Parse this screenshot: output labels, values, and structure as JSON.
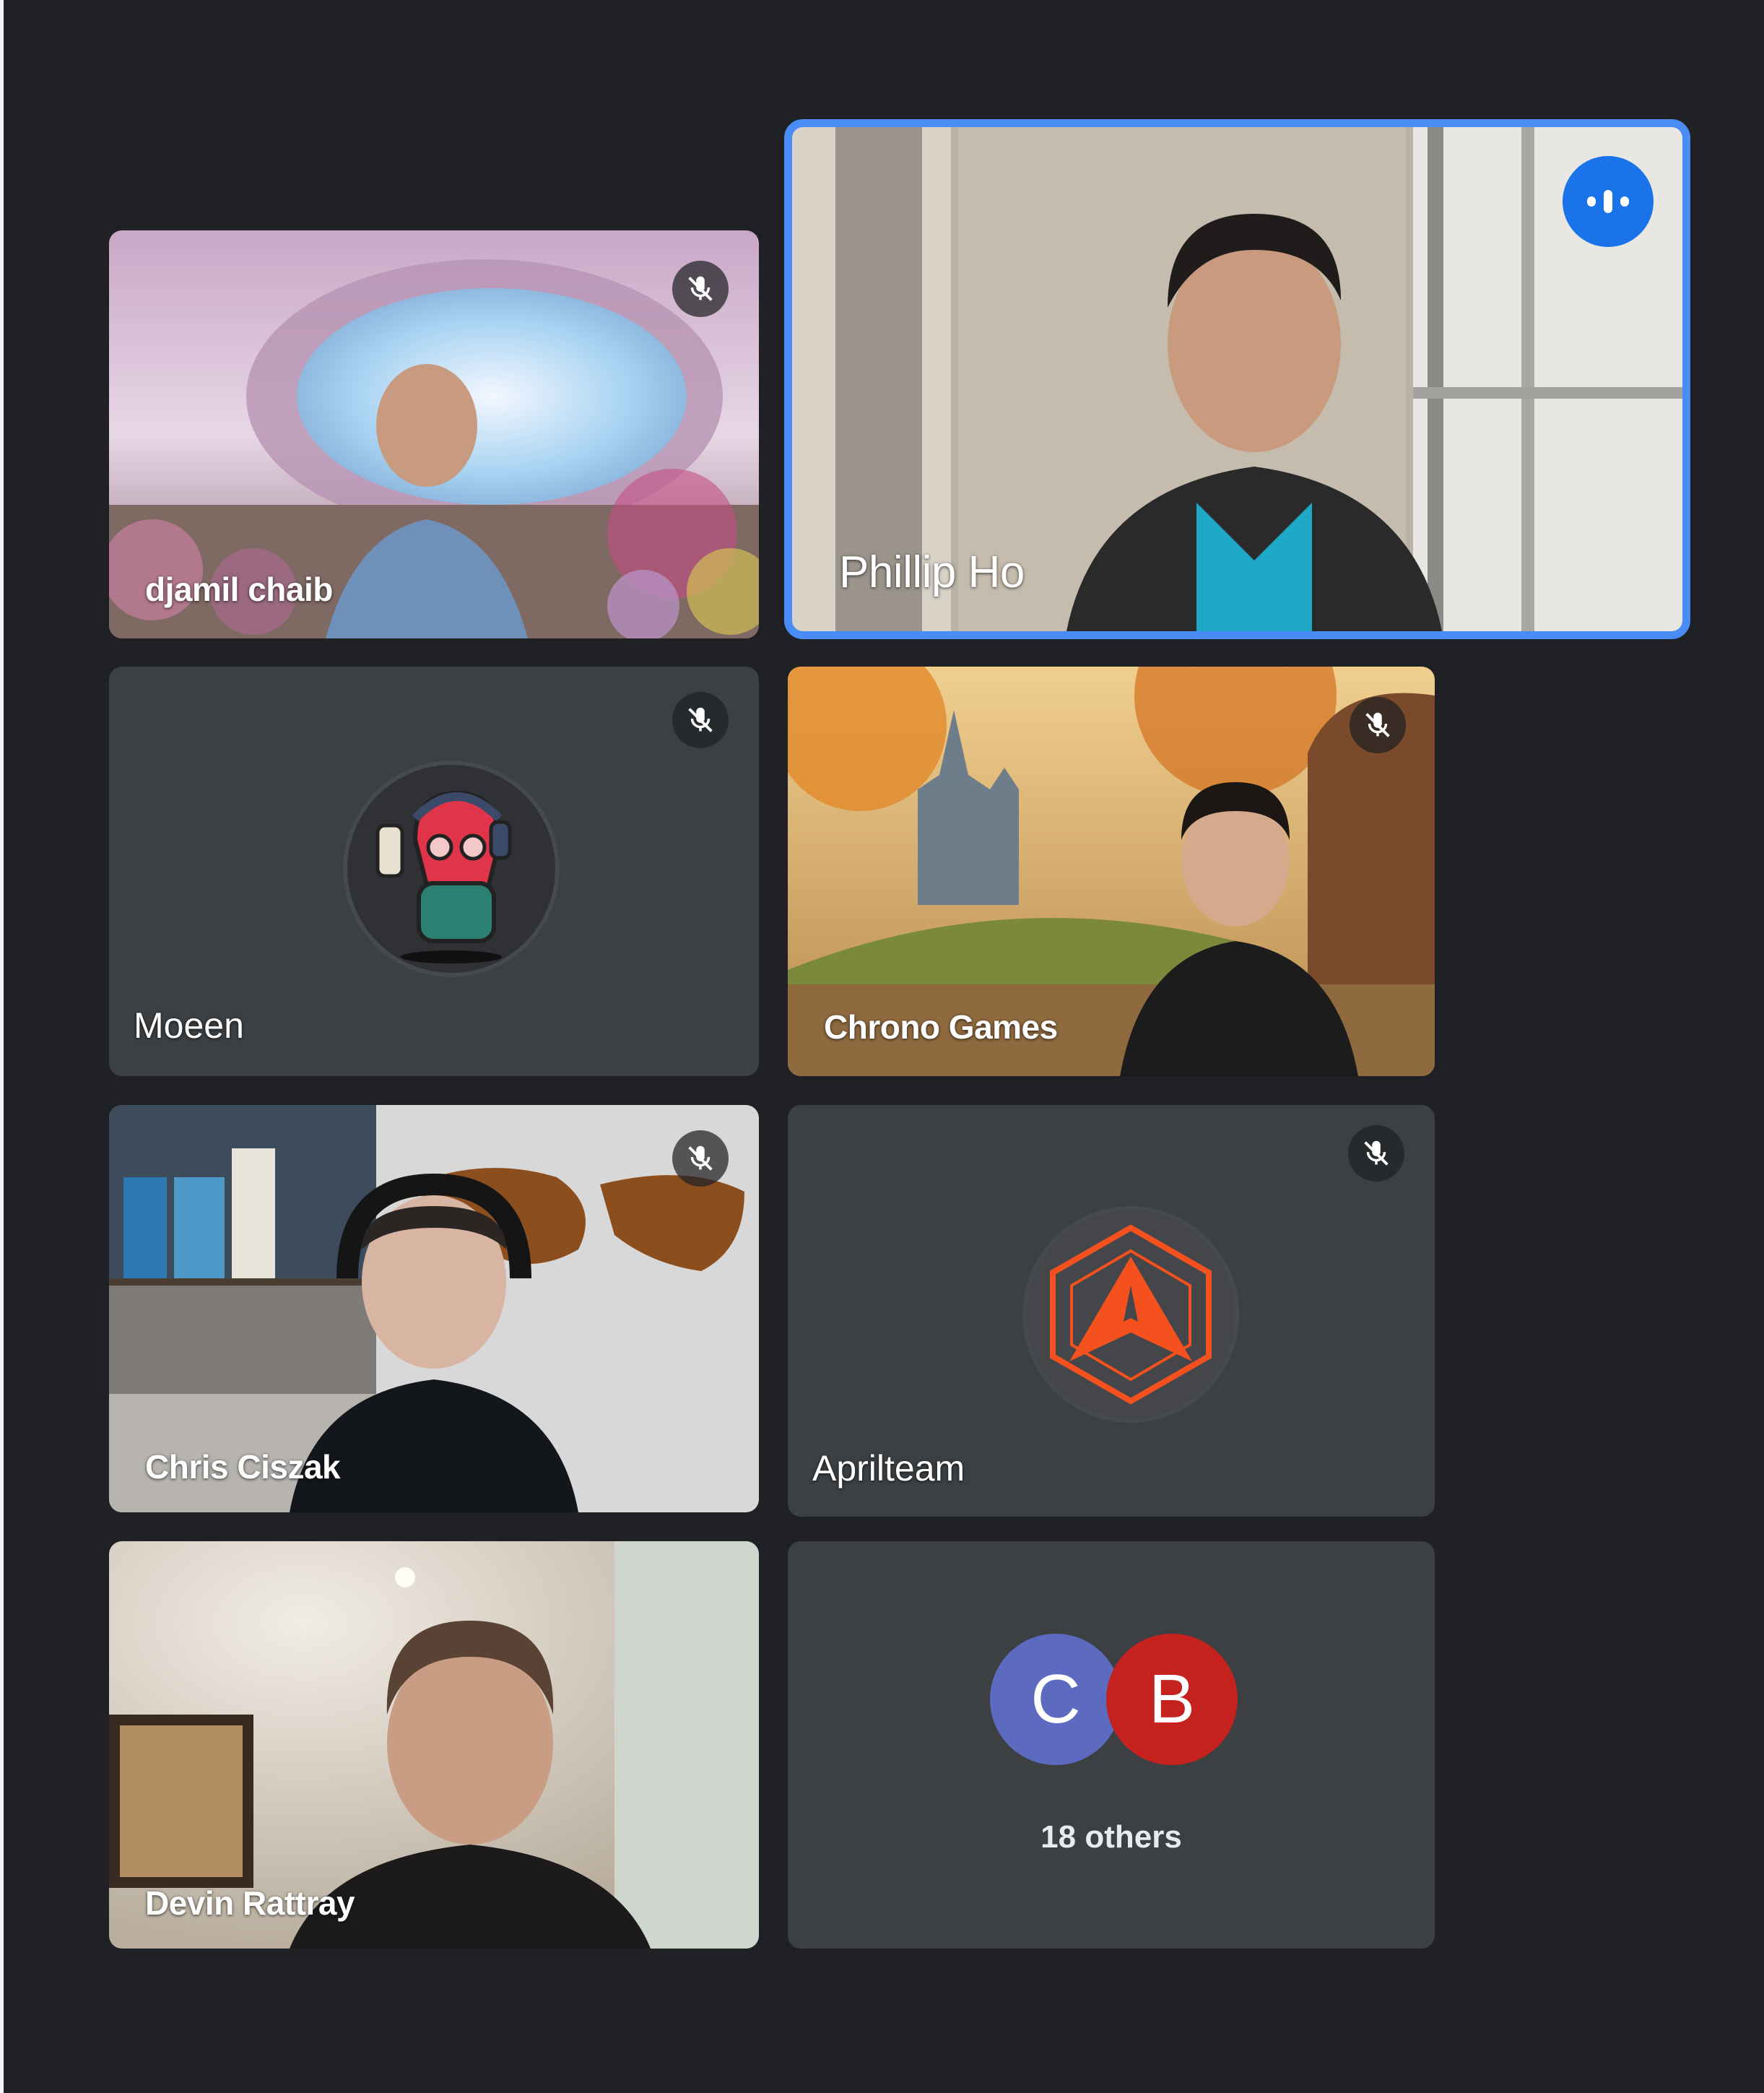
{
  "participants": [
    {
      "name": "djamil chaib",
      "muted": true
    },
    {
      "name": "Phillip Ho",
      "muted": false,
      "speaking": true
    },
    {
      "name": "Moeen",
      "muted": true
    },
    {
      "name": "Chrono Games",
      "muted": true
    },
    {
      "name": "Chris Ciszak",
      "muted": true
    },
    {
      "name": "Aprilteam",
      "muted": true
    },
    {
      "name": "Devin Rattray",
      "muted": false
    }
  ],
  "others": {
    "avatars": [
      {
        "letter": "C",
        "color": "#5c6bc0"
      },
      {
        "letter": "B",
        "color": "#c5221f"
      }
    ],
    "label": "18 others"
  },
  "colors": {
    "background": "#202124",
    "tile": "#3c4043",
    "active_speaker_border": "#4a8cf6",
    "speaking_indicator": "#1a73e8",
    "aprilteam_logo": "#f4511e"
  },
  "icons": {
    "muted": "mic-off-icon",
    "speaking": "audio-level-icon"
  }
}
